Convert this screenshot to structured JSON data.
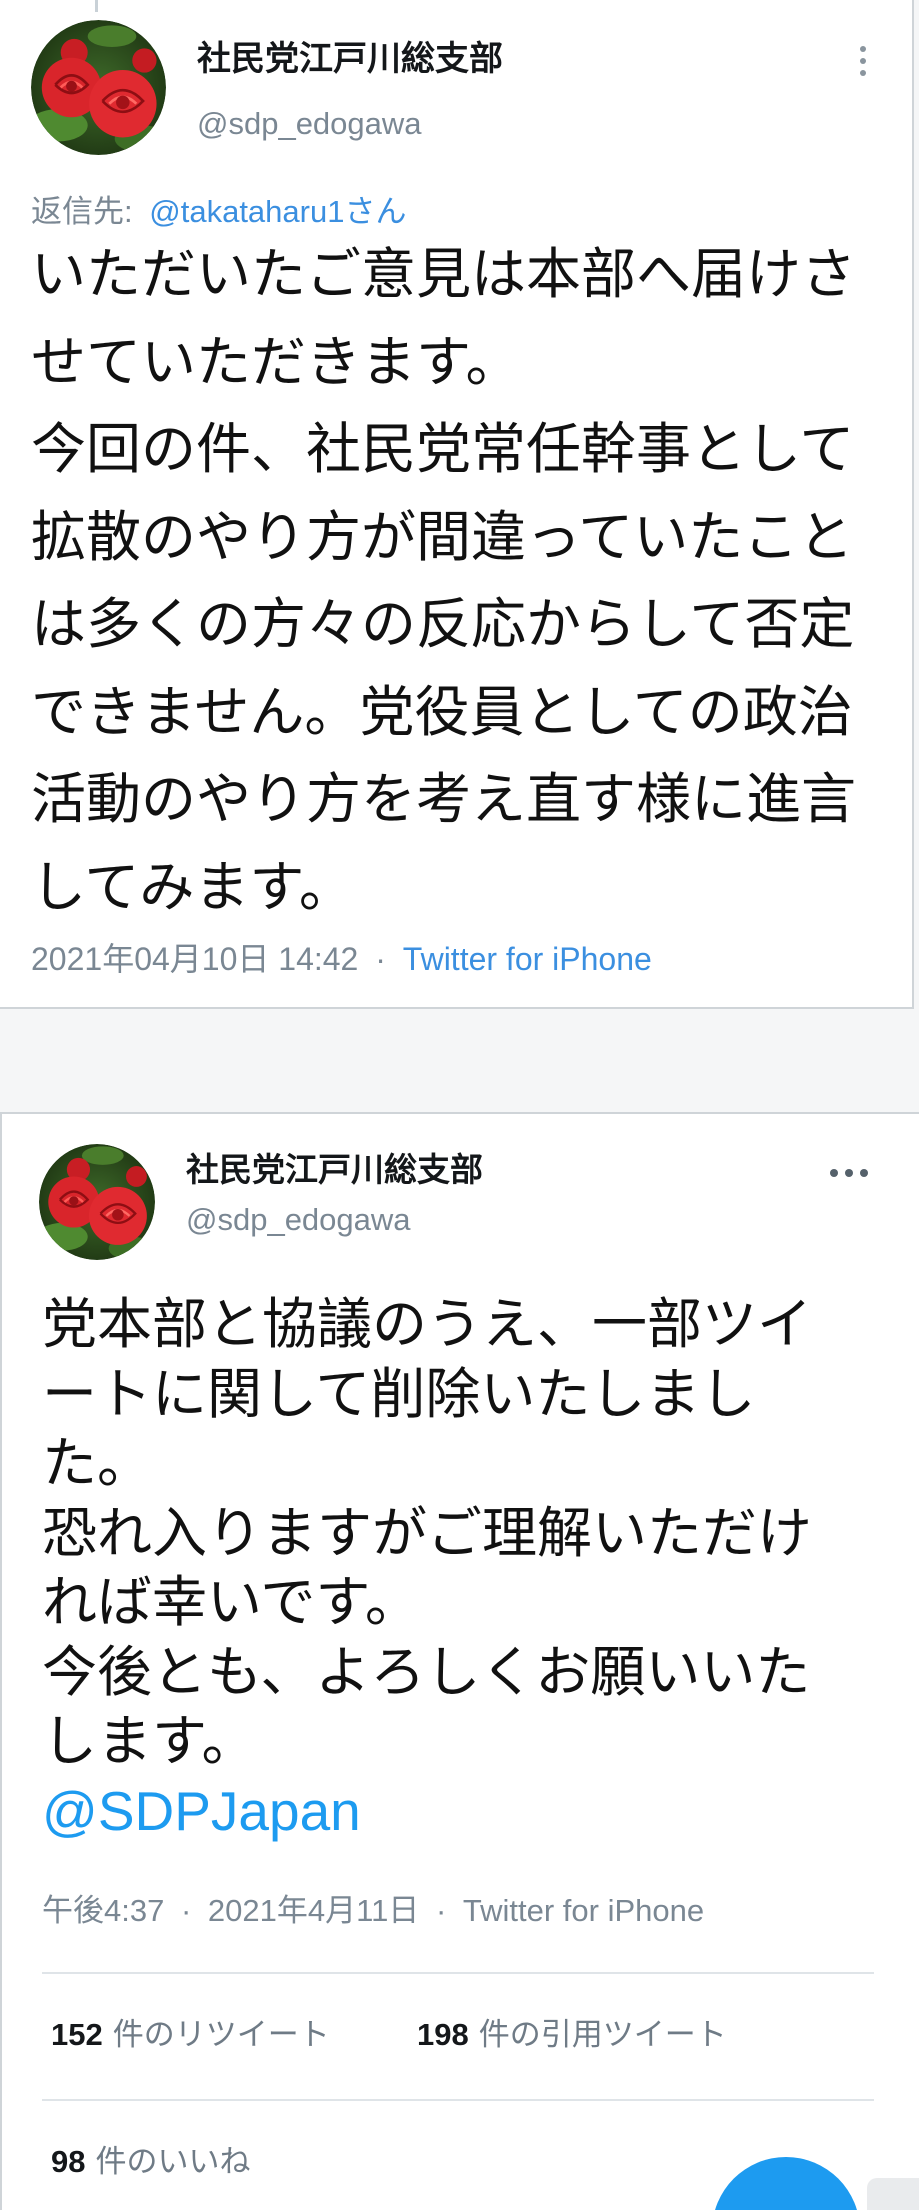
{
  "colors": {
    "text": "#14171a",
    "muted": "#7a8793",
    "link": "#3b8fe0",
    "accent": "#1d9bf0",
    "divider": "#dfe4e8"
  },
  "icons": {
    "tweet1_menu": "more-vertical-icon",
    "tweet2_menu": "more-horizontal-icon",
    "fab": "compose-fab"
  },
  "tweets": [
    {
      "author_name": "社民党江戸川総支部",
      "author_handle": "@sdp_edogawa",
      "reply_to_label": "返信先:",
      "reply_to_handle": "@takataharu1さん",
      "text_lines": [
        "いただいたご意見は本部へ届けさ",
        "せていただきます。",
        "今回の件、社民党常任幹事として",
        "拡散のやり方が間違っていたこと",
        "は多くの方々の反応からして否定",
        "できません。党役員としての政治",
        "活動のやり方を考え直す様に進言",
        "してみます。"
      ],
      "timestamp": "2021年04月10日 14:42",
      "separator": "·",
      "source": "Twitter for iPhone"
    },
    {
      "author_name": "社民党江戸川総支部",
      "author_handle": "@sdp_edogawa",
      "text_lines": [
        "党本部と協議のうえ、一部ツイ",
        "ートに関して削除いたしまし",
        "た。",
        "恐れ入りますがご理解いただけ",
        "れば幸いです。",
        "今後とも、よろしくお願いいた",
        "します。"
      ],
      "mention": "@SDPJapan",
      "time": "午後4:37",
      "separator": "·",
      "date": "2021年4月11日",
      "source": "Twitter for iPhone",
      "retweets": {
        "count": "152",
        "label": "件のリツイート"
      },
      "quotes": {
        "count": "198",
        "label": "件の引用ツイート"
      },
      "likes": {
        "count": "98",
        "label": "件のいいね"
      }
    }
  ]
}
